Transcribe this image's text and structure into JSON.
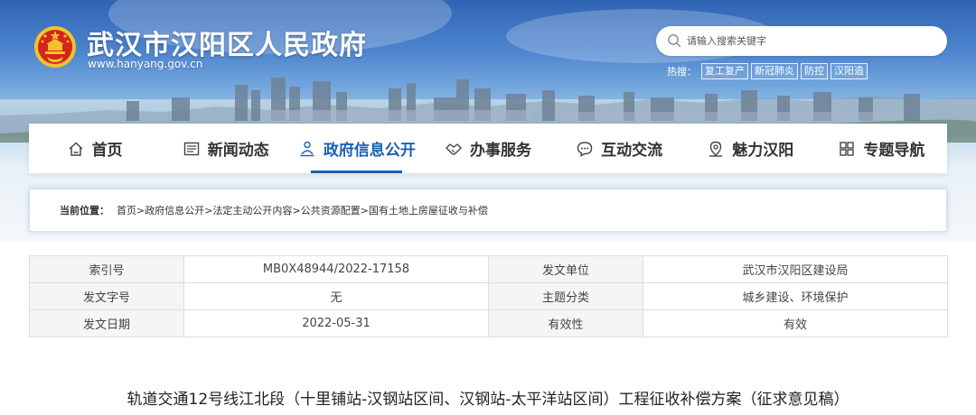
{
  "header": {
    "site_title": "武汉市汉阳区人民政府",
    "site_url": "www.hanyang.gov.cn",
    "search_placeholder": "请输入搜索关键字",
    "hot_label": "热搜：",
    "hot_tags": [
      "复工复产",
      "新冠肺炎",
      "防控",
      "汉阳造"
    ]
  },
  "nav": {
    "items": [
      {
        "label": "首页",
        "icon": "home-icon"
      },
      {
        "label": "新闻动态",
        "icon": "news-icon"
      },
      {
        "label": "政府信息公开",
        "icon": "government-icon",
        "active": true
      },
      {
        "label": "办事服务",
        "icon": "handshake-icon"
      },
      {
        "label": "互动交流",
        "icon": "chat-icon"
      },
      {
        "label": "魅力汉阳",
        "icon": "location-icon"
      },
      {
        "label": "专题导航",
        "icon": "grid-icon"
      }
    ],
    "active_color": "#1a5fb4"
  },
  "breadcrumb": {
    "label": "当前位置：",
    "items": [
      "首页",
      "政府信息公开",
      "法定主动公开内容",
      "公共资源配置",
      "国有土地上房屋征收与补偿"
    ],
    "separator": ">"
  },
  "meta": {
    "rows": [
      [
        {
          "label": "索引号",
          "value": "MB0X48944/2022-17158"
        },
        {
          "label": "发文单位",
          "value": "武汉市汉阳区建设局"
        }
      ],
      [
        {
          "label": "发文字号",
          "value": "无"
        },
        {
          "label": "主题分类",
          "value": "城乡建设、环境保护"
        }
      ],
      [
        {
          "label": "发文日期",
          "value": "2022-05-31"
        },
        {
          "label": "有效性",
          "value": "有效"
        }
      ]
    ]
  },
  "document": {
    "title": "轨道交通12号线江北段（十里铺站-汉钢站区间、汉钢站-太平洋站区间）工程征收补偿方案（征求意见稿）"
  }
}
